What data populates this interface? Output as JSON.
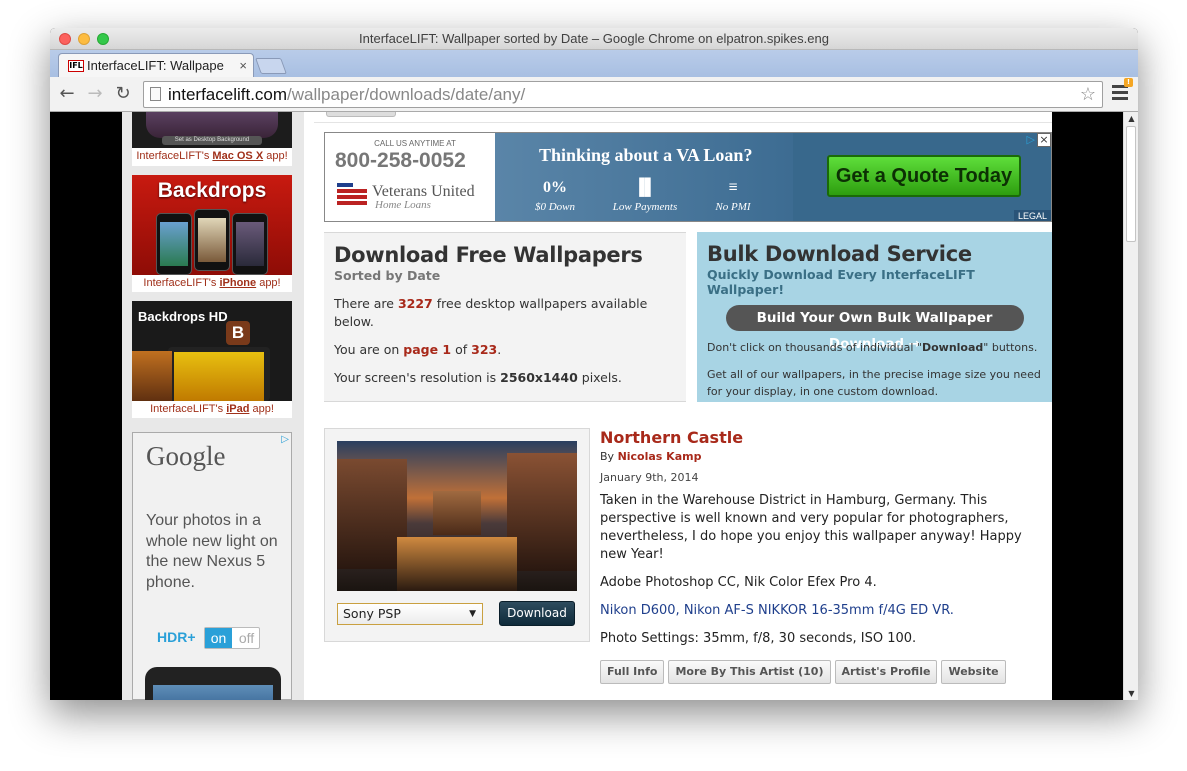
{
  "window": {
    "title": "InterfaceLIFT: Wallpaper sorted by Date – Google Chrome on elpatron.spikes.eng"
  },
  "tab": {
    "favicon_text": "IFL",
    "title": "InterfaceLIFT: Wallpape",
    "close_glyph": "×"
  },
  "nav": {
    "back_glyph": "←",
    "forward_glyph": "→",
    "reload_glyph": "↻"
  },
  "address": {
    "host": "interfacelift.com",
    "path": "/wallpaper/downloads/date/any/",
    "star_glyph": "☆"
  },
  "menu_badge": "!",
  "sidebar": {
    "mac_button": "Set as Desktop Background",
    "mac_caption_pre": "InterfaceLIFT's ",
    "mac_caption_link": "Mac OS X",
    "mac_caption_post": " app!",
    "backdrops_title": "Backdrops",
    "iphone_caption_pre": "InterfaceLIFT's ",
    "iphone_caption_link": "iPhone",
    "iphone_caption_post": " app!",
    "hd_title": "Backdrops HD",
    "hd_badge": "B",
    "ipad_caption_pre": "InterfaceLIFT's ",
    "ipad_caption_link": "iPad",
    "ipad_caption_post": " app!",
    "google_ad": {
      "logo": "Google",
      "text": "Your photos in a whole new light on the new Nexus 5 phone.",
      "hdr_label": "HDR+",
      "toggle_on": "on",
      "toggle_off": "off"
    }
  },
  "banner": {
    "call_us": "CALL US ANYTIME AT",
    "phone": "800-258-0052",
    "brand": "Veterans United",
    "brand_sub": "Home Loans",
    "question": "Thinking about a VA Loan?",
    "features": [
      {
        "big": "0%",
        "label": "$0 Down"
      },
      {
        "big": "▐▌",
        "label": "Low Payments"
      },
      {
        "big": "≡",
        "label": "No PMI"
      }
    ],
    "cta": "Get a Quote Today",
    "legal": "LEGAL",
    "close": "×"
  },
  "download_box": {
    "title": "Download Free Wallpapers",
    "subtitle": "Sorted by Date",
    "count_pre": "There are ",
    "count": "3227",
    "count_post": " free desktop wallpapers available below.",
    "page_pre": "You are on ",
    "page": "page 1",
    "page_mid": " of ",
    "page_total": "323",
    "page_post": ".",
    "res_pre": "Your screen's resolution is ",
    "resolution": "2560x1440",
    "res_post": " pixels."
  },
  "bulk_box": {
    "title": "Bulk Download Service",
    "subtitle": "Quickly Download Every InterfaceLIFT Wallpaper!",
    "button": "Build Your Own Bulk Wallpaper Download →",
    "p1_pre": "Don't click on thousands of individual \"",
    "p1_bold": "Download",
    "p1_post": "\" buttons.",
    "p2": "Get all of our wallpapers, in the precise image size you need for your display, in one custom download."
  },
  "wallpaper": {
    "title": "Northern Castle",
    "by_label": "By ",
    "author": "Nicolas Kamp",
    "date": "January 9th, 2014",
    "description": "Taken in the Warehouse District in Hamburg, Germany. This perspective is well known and very popular for photographers, nevertheless, I do hope you enjoy this wallpaper anyway! Happy new Year!",
    "software": "Adobe Photoshop CC, Nik Color Efex Pro 4.",
    "gear": "Nikon D600, Nikon AF-S NIKKOR 16-35mm f/4G ED VR.",
    "settings": "Photo Settings: 35mm, f/8, 30 seconds, ISO 100.",
    "resolution_select": "Sony PSP",
    "download_button": "Download",
    "actions": [
      "Full Info",
      "More By This Artist (10)",
      "Artist's Profile",
      "Website"
    ]
  }
}
